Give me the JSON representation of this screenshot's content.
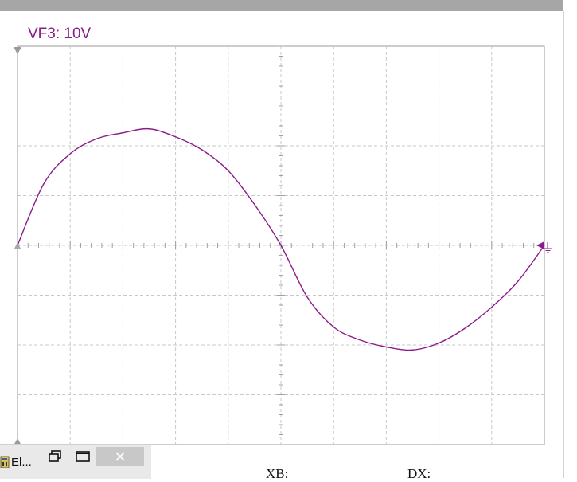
{
  "scope": {
    "channel_label": "VF3: 10V",
    "trace_color": "#8b1a8b",
    "grid_color": "#c8c8c8"
  },
  "chart_data": {
    "type": "line",
    "series": [
      {
        "x": [
          0,
          0.05,
          0.1,
          0.15,
          0.2,
          0.25,
          0.3,
          0.35,
          0.4,
          0.45,
          0.5,
          0.55,
          0.6,
          0.65,
          0.7,
          0.75,
          0.8,
          0.85,
          0.9,
          0.95,
          1.0
        ],
        "values": [
          0,
          0.62,
          0.92,
          1.07,
          1.13,
          1.17,
          1.09,
          0.96,
          0.75,
          0.41,
          0,
          -0.52,
          -0.82,
          -0.95,
          -1.02,
          -1.05,
          -0.98,
          -0.83,
          -0.62,
          -0.36,
          0
        ]
      }
    ],
    "xlim": [
      0,
      1
    ],
    "ylim": [
      -2,
      2
    ],
    "grid": true,
    "grid_divisions_x": 10,
    "grid_divisions_y": 8
  },
  "taskbar": {
    "app_label": "El...",
    "restore_icon": "restore-icon",
    "maximize_icon": "maximize-icon",
    "close_icon": "close-icon"
  },
  "readouts": {
    "xb_label": "XB:",
    "dx_label": "DX:"
  }
}
